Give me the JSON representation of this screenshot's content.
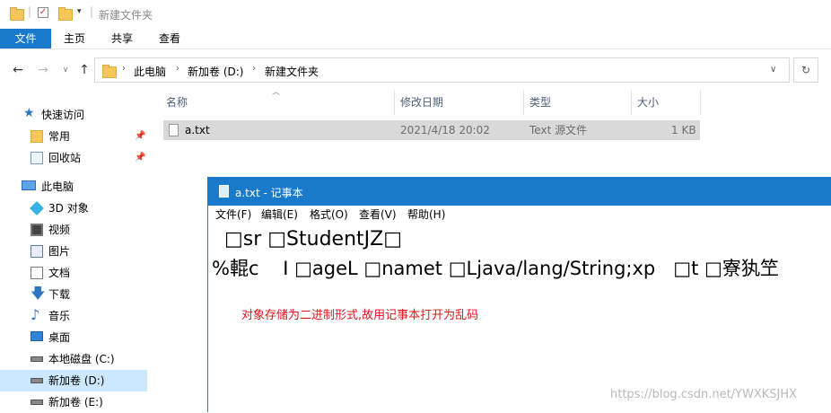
{
  "window": {
    "title": "新建文件夹"
  },
  "ribbon": {
    "tabs": [
      "文件",
      "主页",
      "共享",
      "查看"
    ]
  },
  "address": {
    "crumbs": [
      "此电脑",
      "新加卷 (D:)",
      "新建文件夹"
    ]
  },
  "nav": {
    "items": [
      {
        "label": "快速访问"
      },
      {
        "label": "常用"
      },
      {
        "label": "回收站"
      },
      {
        "label": "此电脑"
      },
      {
        "label": "3D 对象"
      },
      {
        "label": "视频"
      },
      {
        "label": "图片"
      },
      {
        "label": "文档"
      },
      {
        "label": "下载"
      },
      {
        "label": "音乐"
      },
      {
        "label": "桌面"
      },
      {
        "label": "本地磁盘 (C:)"
      },
      {
        "label": "新加卷 (D:)"
      },
      {
        "label": "新加卷 (E:)"
      }
    ]
  },
  "filelist": {
    "columns": [
      "名称",
      "修改日期",
      "类型",
      "大小"
    ],
    "rows": [
      {
        "name": "a.txt",
        "modified": "2021/4/18 20:02",
        "type": "Text 源文件",
        "size": "1 KB"
      }
    ]
  },
  "notepad": {
    "title": "a.txt - 记事本",
    "menu": [
      "文件(F)",
      "编辑(E)",
      "格式(O)",
      "查看(V)",
      "帮助(H)"
    ],
    "line1": "  □sr □StudentJZ□",
    "line2": "%輥c    I □ageL □namet □Ljava/lang/String;xp   □t □寮犱笁",
    "note": "对象存储为二进制形式,故用记事本打开为乱码"
  },
  "watermark": "https://blog.csdn.net/YWXKSJHX",
  "colors": {
    "accent": "#1979ca",
    "note": "#e2141a",
    "selected": "#cce8ff"
  }
}
